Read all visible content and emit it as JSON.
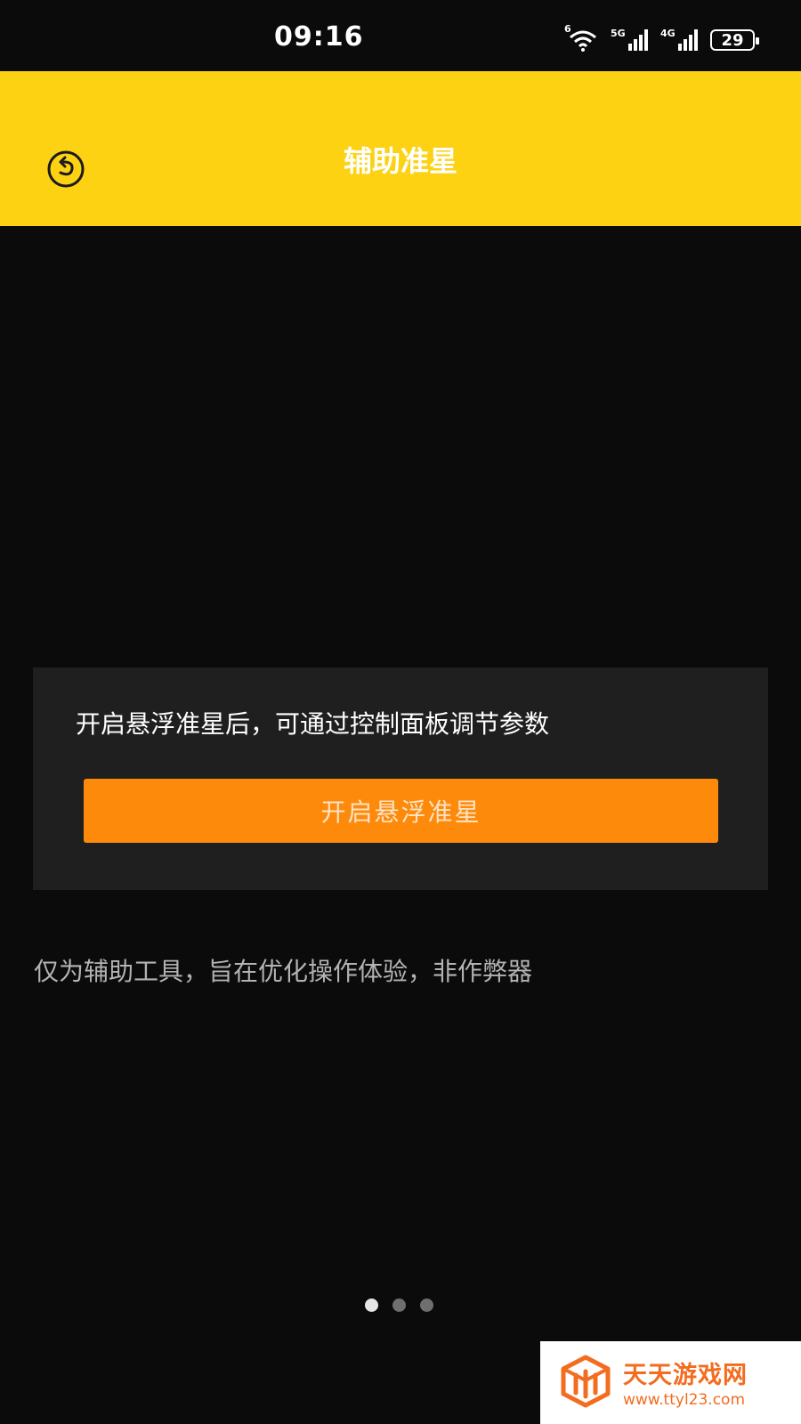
{
  "status_bar": {
    "time": "09:16",
    "wifi_badge": "6",
    "signal_1_label": "5G",
    "signal_2_label": "4G",
    "battery": "29"
  },
  "header": {
    "title": "辅助准星",
    "back_icon": "back-arrow-circle-icon",
    "background_color": "#fdd213"
  },
  "card": {
    "description": "开启悬浮准星后，可通过控制面板调节参数",
    "button_label": "开启悬浮准星",
    "button_color": "#fd8a0b"
  },
  "disclaimer": "仅为辅助工具，旨在优化操作体验，非作弊器",
  "pager": {
    "count": 3,
    "active_index": 0
  },
  "watermark": {
    "name": "天天游戏网",
    "url": "www.ttyl23.com",
    "color": "#f36c1f"
  }
}
